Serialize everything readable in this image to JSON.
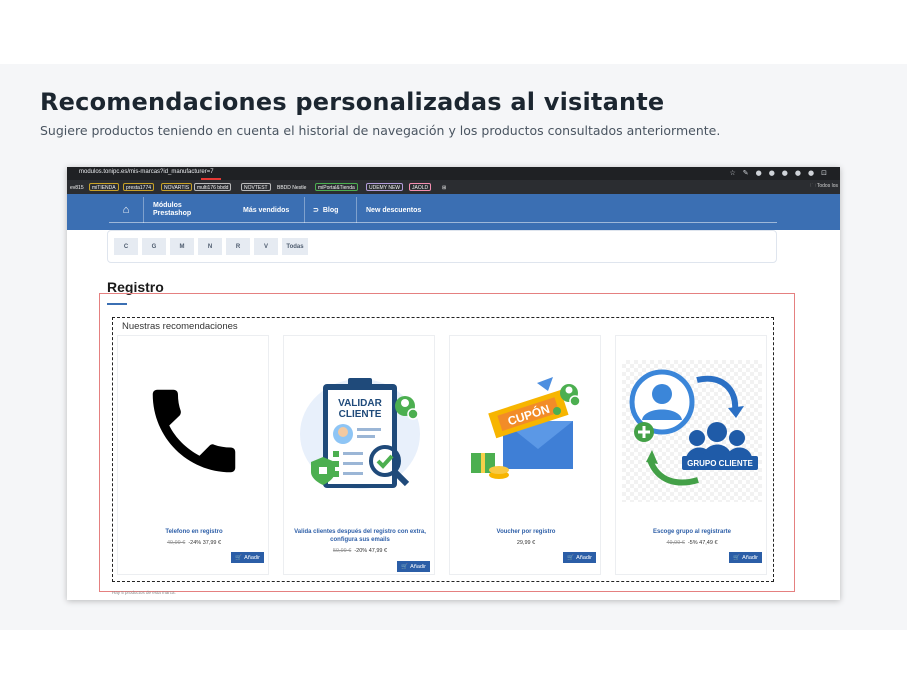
{
  "hero": {
    "title": "Recomendaciones personalizadas al visitante",
    "subtitle": "Sugiere productos teniendo en cuenta el historial de navegación y los productos consultados anteriormente."
  },
  "browser": {
    "url": "modulos.tonipc.es/mis-marcas?id_manufacturer=7",
    "bookmarks": [
      "ev815",
      "miTIENDA",
      "presta1774",
      "NOVARTIS",
      "multi176 bbdd",
      "NOVTEST",
      "BBDD Nestle",
      "miPortal&Tienda",
      "UDEMY NEW",
      "JAOLD"
    ],
    "bookmarks_right": "Todos los"
  },
  "site_nav": {
    "home_icon": "home-icon",
    "modulos": "Módulos",
    "prestashop": "Prestashop",
    "mas_vendidos": "Más vendidos",
    "blog": "Blog",
    "new_descuentos": "New descuentos"
  },
  "filters": [
    "C",
    "G",
    "M",
    "N",
    "R",
    "V",
    "Todas"
  ],
  "section": {
    "title": "Registro",
    "recs_title": "Nuestras recomendaciones",
    "footnote": "Hay 5 productos de esta marca."
  },
  "products": [
    {
      "name": "Telefono en registro",
      "old_price": "49,99 €",
      "discount": "-24%",
      "price": "37,99 €",
      "button": "Añadir",
      "image": "phone-image"
    },
    {
      "name": "Valida clientes después del registro con extra, configura sus emails",
      "old_price": "59,99 €",
      "discount": "-20%",
      "price": "47,99 €",
      "button": "Añadir",
      "image": "validar-cliente-image",
      "img_text_1": "VALIDAR",
      "img_text_2": "CLIENTE"
    },
    {
      "name": "Voucher por registro",
      "old_price": "",
      "discount": "",
      "price": "29,99 €",
      "button": "Añadir",
      "image": "voucher-image",
      "img_text_1": "CUPÓN"
    },
    {
      "name": "Escoge grupo al registrarte",
      "old_price": "49,99 €",
      "discount": "-5%",
      "price": "47,49 €",
      "button": "Añadir",
      "image": "grupo-cliente-image",
      "img_text_1": "GRUPO CLIENTE"
    }
  ],
  "colors": {
    "nav_blue": "#3b6fb3",
    "link_blue": "#2e5fa8",
    "button_blue": "#2b5ea7",
    "accent_red": "#e58080"
  }
}
